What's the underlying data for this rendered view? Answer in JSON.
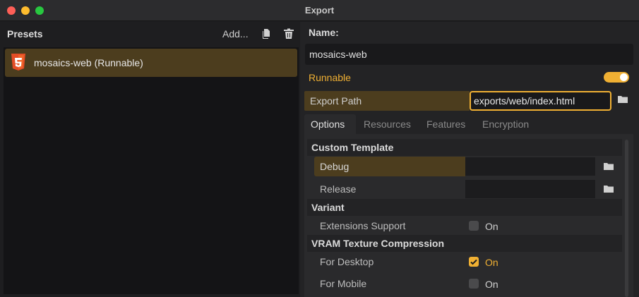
{
  "window": {
    "title": "Export"
  },
  "presets": {
    "label": "Presets",
    "add_label": "Add...",
    "items": [
      {
        "label": "mosaics-web (Runnable)",
        "icon": "html5-icon"
      }
    ]
  },
  "preset": {
    "name_label": "Name:",
    "name_value": "mosaics-web",
    "runnable_label": "Runnable",
    "runnable_on": true,
    "export_path_label": "Export Path",
    "export_path_value": "exports/web/index.html"
  },
  "tabs": [
    {
      "label": "Options",
      "active": true
    },
    {
      "label": "Resources",
      "active": false
    },
    {
      "label": "Features",
      "active": false
    },
    {
      "label": "Encryption",
      "active": false
    }
  ],
  "options": {
    "custom_template": {
      "header": "Custom Template",
      "debug_label": "Debug",
      "release_label": "Release"
    },
    "variant": {
      "header": "Variant",
      "extensions_label": "Extensions Support",
      "extensions_value": "On",
      "extensions_checked": false
    },
    "vram": {
      "header": "VRAM Texture Compression",
      "desktop_label": "For Desktop",
      "desktop_value": "On",
      "desktop_checked": true,
      "mobile_label": "For Mobile",
      "mobile_value": "On",
      "mobile_checked": false
    }
  },
  "colors": {
    "accent": "#f0b033",
    "selection": "#4c3d1e"
  }
}
